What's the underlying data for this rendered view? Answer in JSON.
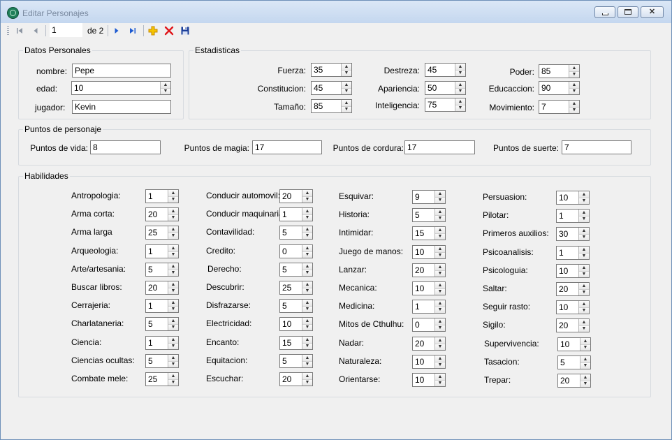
{
  "window": {
    "title": "Editar Personajes"
  },
  "icons": {
    "app": "app-globe-icon",
    "first": "move-first-icon",
    "prev": "move-previous-icon",
    "next": "move-next-icon",
    "last": "move-last-icon",
    "add": "add-new-icon",
    "delete": "delete-icon",
    "save": "save-icon"
  },
  "colors": {
    "accent": "#1e5bd1",
    "add": "#f5b800",
    "delete": "#e0161b",
    "save": "#1c3f9a"
  },
  "navigator": {
    "position": "1",
    "total": "de 2"
  },
  "datos": {
    "legend": "Datos Personales",
    "nombre_label": "nombre:",
    "nombre": "Pepe",
    "edad_label": "edad:",
    "edad": "10",
    "jugador_label": "jugador:",
    "jugador": "Kevin"
  },
  "stats": {
    "legend": "Estadisticas",
    "items": [
      {
        "label": "Fuerza:",
        "value": "35"
      },
      {
        "label": "Constitucion:",
        "value": "45"
      },
      {
        "label": "Tamaño:",
        "value": "85"
      },
      {
        "label": "Destreza:",
        "value": "45"
      },
      {
        "label": "Apariencia:",
        "value": "50"
      },
      {
        "label": "Inteligencia:",
        "value": "75"
      },
      {
        "label": "Poder:",
        "value": "85"
      },
      {
        "label": "Educaccion:",
        "value": "90"
      },
      {
        "label": "Movimiento:",
        "value": "7"
      }
    ]
  },
  "puntos": {
    "legend": "Puntos de personaje",
    "items": [
      {
        "label": "Puntos de vida:",
        "value": "8"
      },
      {
        "label": "Puntos de magia:",
        "value": "17"
      },
      {
        "label": "Puntos de cordura:",
        "value": "17"
      },
      {
        "label": "Puntos de suerte:",
        "value": "7"
      }
    ]
  },
  "habilidades": {
    "legend": "Habilidades",
    "items": [
      {
        "label": "Antropologia:",
        "value": "1"
      },
      {
        "label": "Arma corta:",
        "value": "20"
      },
      {
        "label": "Arma larga",
        "value": "25"
      },
      {
        "label": "Arqueologia:",
        "value": "1"
      },
      {
        "label": "Arte/artesania:",
        "value": "5"
      },
      {
        "label": "Buscar libros:",
        "value": "20"
      },
      {
        "label": "Cerrajeria:",
        "value": "1"
      },
      {
        "label": "Charlataneria:",
        "value": "5"
      },
      {
        "label": "Ciencia:",
        "value": "1"
      },
      {
        "label": "Ciencias ocultas:",
        "value": "5"
      },
      {
        "label": "Combate mele:",
        "value": "25"
      },
      {
        "label": "Conducir automovil:",
        "value": "20"
      },
      {
        "label": "Conducir maquinaria:",
        "value": "1"
      },
      {
        "label": "Contavilidad:",
        "value": "5"
      },
      {
        "label": "Credito:",
        "value": "0"
      },
      {
        "label": "Derecho:",
        "value": "5"
      },
      {
        "label": "Descubrir:",
        "value": "25"
      },
      {
        "label": "Disfrazarse:",
        "value": "5"
      },
      {
        "label": "Electricidad:",
        "value": "10"
      },
      {
        "label": "Encanto:",
        "value": "15"
      },
      {
        "label": "Equitacion:",
        "value": "5"
      },
      {
        "label": "Escuchar:",
        "value": "20"
      },
      {
        "label": "Esquivar:",
        "value": "9"
      },
      {
        "label": "Historia:",
        "value": "5"
      },
      {
        "label": "Intimidar:",
        "value": "15"
      },
      {
        "label": "Juego de manos:",
        "value": "10"
      },
      {
        "label": "Lanzar:",
        "value": "20"
      },
      {
        "label": "Mecanica:",
        "value": "10"
      },
      {
        "label": "Medicina:",
        "value": "1"
      },
      {
        "label": "Mitos de Cthulhu:",
        "value": "0"
      },
      {
        "label": "Nadar:",
        "value": "20"
      },
      {
        "label": "Naturaleza:",
        "value": "10"
      },
      {
        "label": "Orientarse:",
        "value": "10"
      },
      {
        "label": "Persuasion:",
        "value": "10"
      },
      {
        "label": "Pilotar:",
        "value": "1"
      },
      {
        "label": "Primeros auxilios:",
        "value": "30"
      },
      {
        "label": "Psicoanalisis:",
        "value": "1"
      },
      {
        "label": "Psicologuia:",
        "value": "10"
      },
      {
        "label": "Saltar:",
        "value": "20"
      },
      {
        "label": "Seguir rasto:",
        "value": "10"
      },
      {
        "label": "Sigilo:",
        "value": "20"
      },
      {
        "label": "Supervivencia:",
        "value": "10"
      },
      {
        "label": "Tasacion:",
        "value": "5"
      },
      {
        "label": "Trepar:",
        "value": "20"
      }
    ]
  }
}
